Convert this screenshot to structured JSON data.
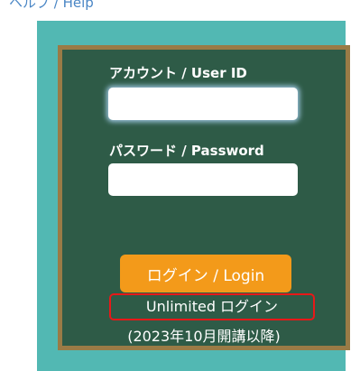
{
  "header": {
    "help_link": "ヘルプ / Help"
  },
  "form": {
    "userid_label": "アカウント / User ID",
    "userid_value": "",
    "password_label": "パスワード / Password",
    "password_value": "",
    "login_button": "ログイン / Login",
    "unlimited_login": "Unlimited ログイン",
    "note": "(2023年10月開講以降)"
  },
  "colors": {
    "teal_panel": "#52b8b3",
    "board": "#2e5b47",
    "board_frame": "#9a7b46",
    "login_button": "#f39a1a",
    "highlight_box": "#e81818",
    "help_link": "#4a86c5"
  }
}
